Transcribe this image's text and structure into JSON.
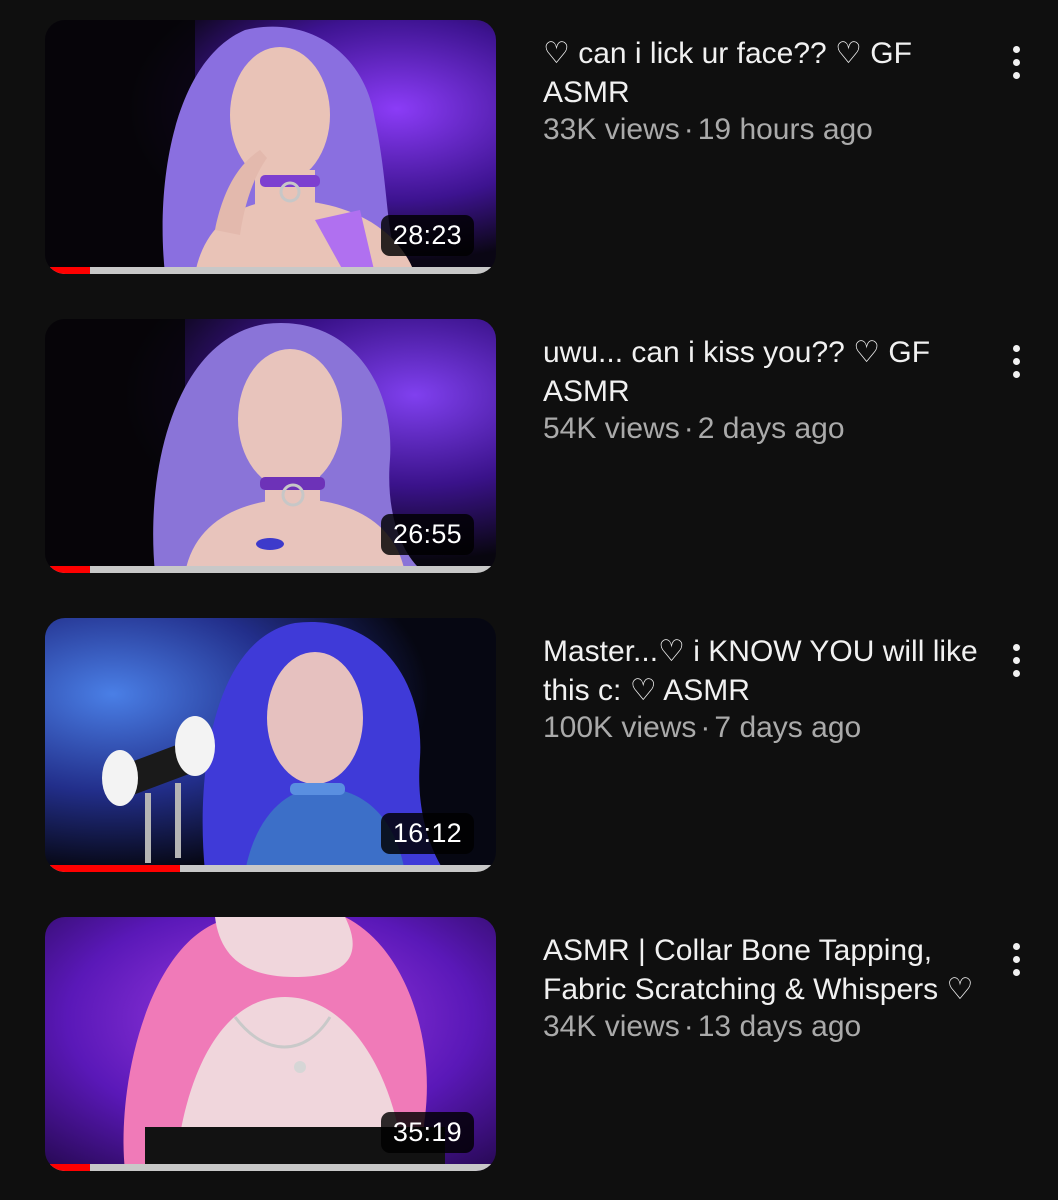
{
  "videos": [
    {
      "title": "♡ can i lick ur face?? ♡ GF ASMR",
      "views": "33K views",
      "age": "19 hours ago",
      "separator": "·",
      "duration": "28:23",
      "watched_fraction": 0.1,
      "thumb_colors": {
        "bg": "#5a1fc4",
        "hair": "#8a6fe0",
        "skin": "#e9c3b7",
        "accent": "#9b59f5"
      }
    },
    {
      "title": "uwu... can i kiss you?? ♡ GF ASMR",
      "views": "54K views",
      "age": "2 days ago",
      "separator": "·",
      "duration": "26:55",
      "watched_fraction": 0.1,
      "thumb_colors": {
        "bg": "#4f1db8",
        "hair": "#8a74d8",
        "skin": "#e8c4bc",
        "accent": "#8a40e8"
      }
    },
    {
      "title": "Master...♡ i KNOW YOU will like this c: ♡ ASMR",
      "views": "100K views",
      "age": "7 days ago",
      "separator": "·",
      "duration": "16:12",
      "watched_fraction": 0.3,
      "thumb_colors": {
        "bg": "#2b3fb8",
        "hair": "#3f3ad8",
        "skin": "#e6c1bf",
        "accent": "#4a7fd6"
      }
    },
    {
      "title": "ASMR | Collar Bone Tapping, Fabric Scratching & Whispers ♡",
      "views": "34K views",
      "age": "13 days ago",
      "separator": "·",
      "duration": "35:19",
      "watched_fraction": 0.1,
      "thumb_colors": {
        "bg": "#6e1fc9",
        "hair": "#f07ab8",
        "skin": "#f0d6dc",
        "accent": "#b33be0"
      }
    }
  ]
}
